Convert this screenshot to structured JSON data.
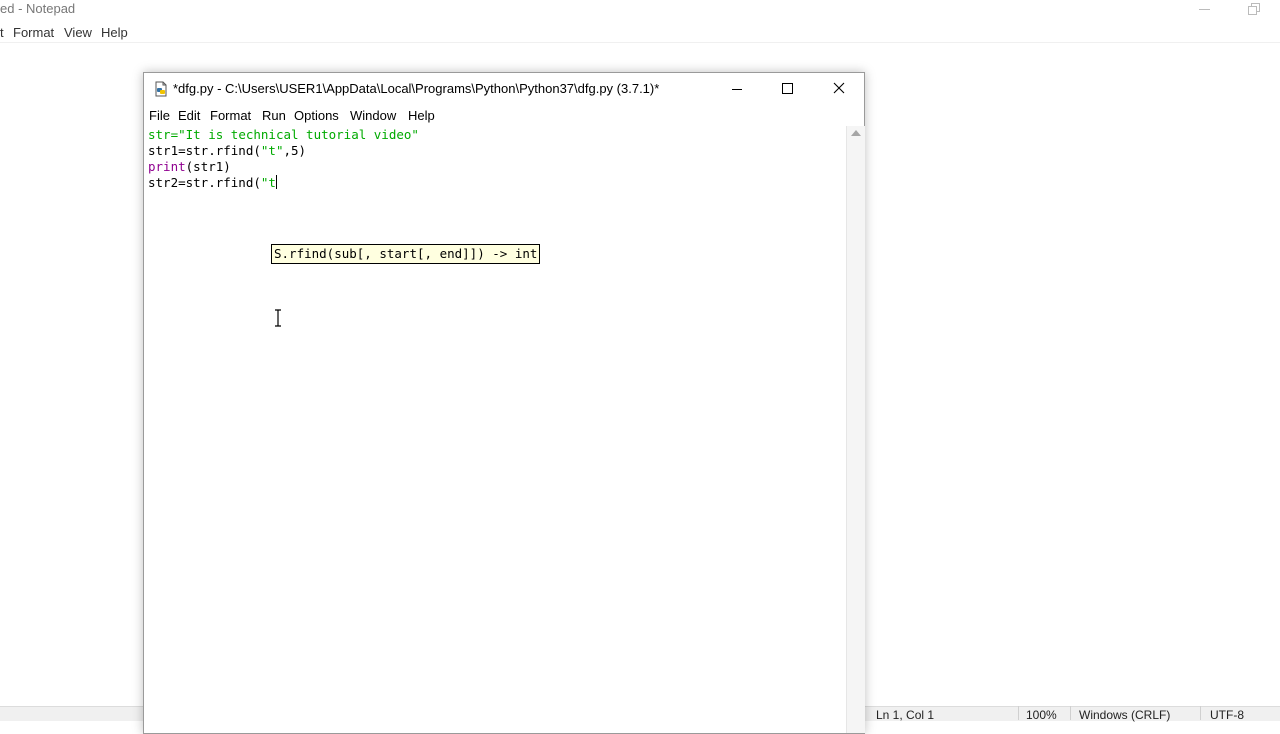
{
  "notepad": {
    "title": "ed - Notepad",
    "menu": [
      "t",
      "Format",
      "View",
      "Help"
    ],
    "status": {
      "position": "Ln 1, Col 1",
      "zoom": "100%",
      "line_ending": "Windows (CRLF)",
      "encoding": "UTF-8"
    }
  },
  "idle": {
    "title": "*dfg.py - C:\\Users\\USER1\\AppData\\Local\\Programs\\Python\\Python37\\dfg.py (3.7.1)*",
    "menu": [
      "File",
      "Edit",
      "Format",
      "Run",
      "Options",
      "Window",
      "Help"
    ],
    "code": {
      "line1": {
        "name": "str",
        "eq": "=",
        "string": "\"It is technical tutorial video\""
      },
      "line2": {
        "text": "str1=str.rfind(",
        "string": "\"t\"",
        "rest": ",5)"
      },
      "line3": {
        "builtin": "print",
        "rest": "(str1)"
      },
      "line4": {
        "text": "str2=str.rfind(",
        "string": "\"t"
      }
    },
    "calltip": "S.rfind(sub[, start[, end]]) -> int"
  },
  "colors": {
    "string": "#00aa00",
    "builtin": "#900090",
    "calltip_bg": "#ffffe0"
  },
  "icons": [
    "python-file-icon",
    "minimize-icon",
    "maximize-icon",
    "close-icon",
    "scroll-up-arrow-icon",
    "ibeam-cursor-icon",
    "restore-icon"
  ]
}
